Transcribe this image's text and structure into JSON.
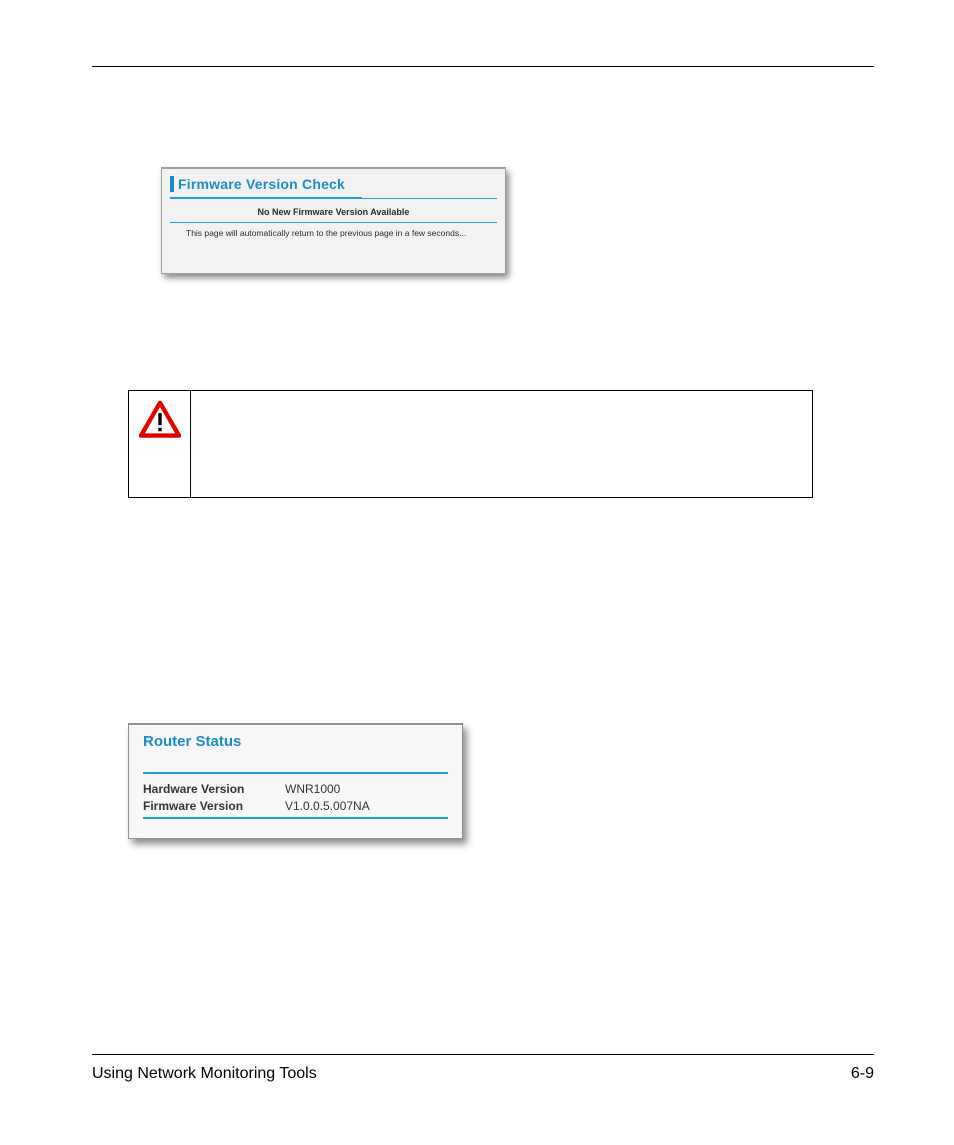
{
  "firmware_check": {
    "title": "Firmware Version Check",
    "status": "No New Firmware Version Available",
    "note": "This page will automatically return to the previous page in a few seconds..."
  },
  "router_status": {
    "title": "Router Status",
    "rows": [
      {
        "label": "Hardware Version",
        "value": "WNR1000"
      },
      {
        "label": "Firmware Version",
        "value": "V1.0.0.5.007NA"
      }
    ]
  },
  "footer": {
    "section": "Using Network Monitoring Tools",
    "page": "6-9"
  }
}
